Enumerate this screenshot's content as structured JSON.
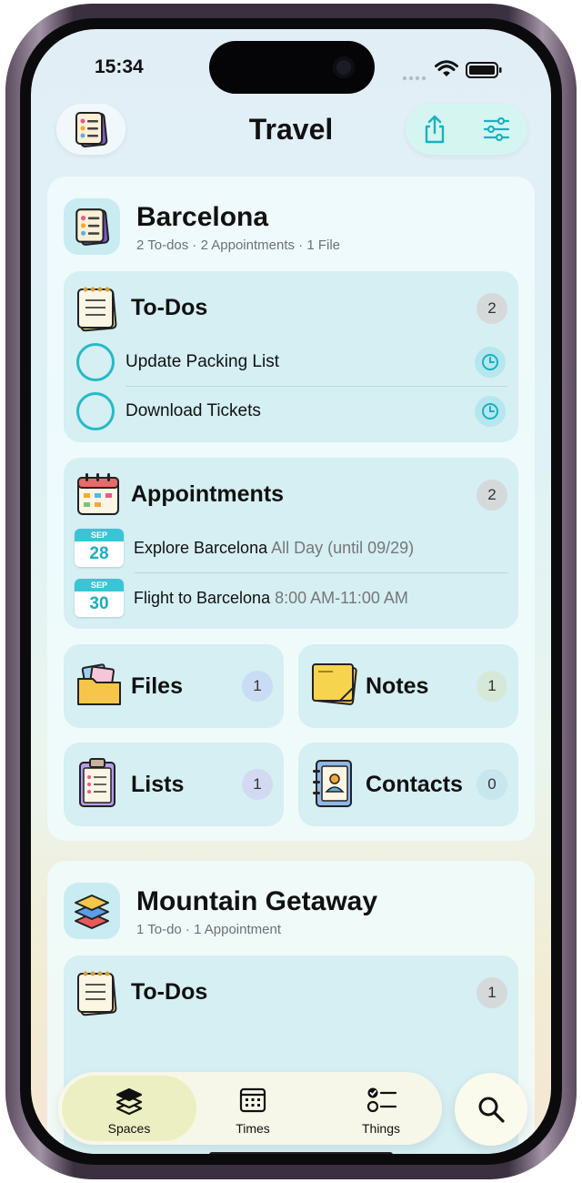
{
  "status_bar": {
    "time": "15:34"
  },
  "header": {
    "title": "Travel"
  },
  "spaces": [
    {
      "name": "Barcelona",
      "summary": "2 To-dos · 2 Appointments · 1 File",
      "todos": {
        "title": "To-Dos",
        "count": "2",
        "items": [
          {
            "label": "Update Packing List"
          },
          {
            "label": "Download Tickets"
          }
        ]
      },
      "appointments": {
        "title": "Appointments",
        "count": "2",
        "items": [
          {
            "month": "SEP",
            "day": "28",
            "title": "Explore Barcelona",
            "time": "All Day (until 09/29)"
          },
          {
            "month": "SEP",
            "day": "30",
            "title": "Flight to Barcelona",
            "time": "8:00 AM-11:00 AM"
          }
        ]
      },
      "tiles": [
        {
          "label": "Files",
          "count": "1"
        },
        {
          "label": "Notes",
          "count": "1"
        },
        {
          "label": "Lists",
          "count": "1"
        },
        {
          "label": "Contacts",
          "count": "0"
        }
      ]
    },
    {
      "name": "Mountain Getaway",
      "summary": "1 To-do · 1 Appointment",
      "todos": {
        "title": "To-Dos",
        "count": "1"
      }
    }
  ],
  "tabbar": {
    "tabs": [
      {
        "label": "Spaces",
        "icon": "layers-icon"
      },
      {
        "label": "Times",
        "icon": "calendar-grid-icon"
      },
      {
        "label": "Things",
        "icon": "checklist-icon"
      }
    ],
    "active": "Spaces"
  },
  "colors": {
    "accent": "#27b9c6",
    "section_bg": "#d5eff3"
  }
}
